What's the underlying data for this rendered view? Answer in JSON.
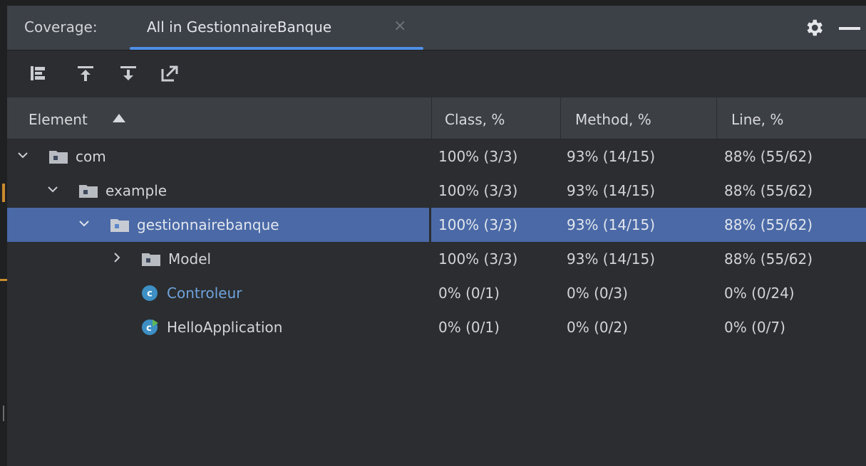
{
  "colors": {
    "accent": "#4f8fe6",
    "selection": "#4a69a6",
    "background": "#2b2d30",
    "header": "#3c3f44"
  },
  "tabbar": {
    "label": "Coverage:",
    "active_tab": "All in GestionnaireBanque",
    "close_symbol": "×",
    "settings_icon": "gear-icon",
    "minimize_icon": "minimize-icon"
  },
  "toolbar": {
    "tools": [
      "flatten-packages-icon",
      "go-up-icon",
      "go-down-icon",
      "generate-report-icon"
    ]
  },
  "table": {
    "columns": [
      "Element",
      "Class, %",
      "Method, %",
      "Line, %"
    ],
    "sort_column": "Element",
    "sort_direction": "ascending",
    "rows": [
      {
        "name": "com",
        "type": "package",
        "expanded": "expanded",
        "class": "100% (3/3)",
        "method": "93% (14/15)",
        "line": "88% (55/62)"
      },
      {
        "name": "example",
        "type": "package",
        "expanded": "expanded",
        "class": "100% (3/3)",
        "method": "93% (14/15)",
        "line": "88% (55/62)"
      },
      {
        "name": "gestionnairebanque",
        "type": "package",
        "expanded": "expanded",
        "selected": "true",
        "class": "100% (3/3)",
        "method": "93% (14/15)",
        "line": "88% (55/62)"
      },
      {
        "name": "Model",
        "type": "package",
        "expanded": "collapsed",
        "class": "100% (3/3)",
        "method": "93% (14/15)",
        "line": "88% (55/62)"
      },
      {
        "name": "Controleur",
        "type": "class",
        "class": "0% (0/1)",
        "method": "0% (0/3)",
        "line": "0% (0/24)"
      },
      {
        "name": "HelloApplication",
        "type": "runnable-class",
        "class": "0% (0/1)",
        "method": "0% (0/2)",
        "line": "0% (0/7)"
      }
    ]
  }
}
